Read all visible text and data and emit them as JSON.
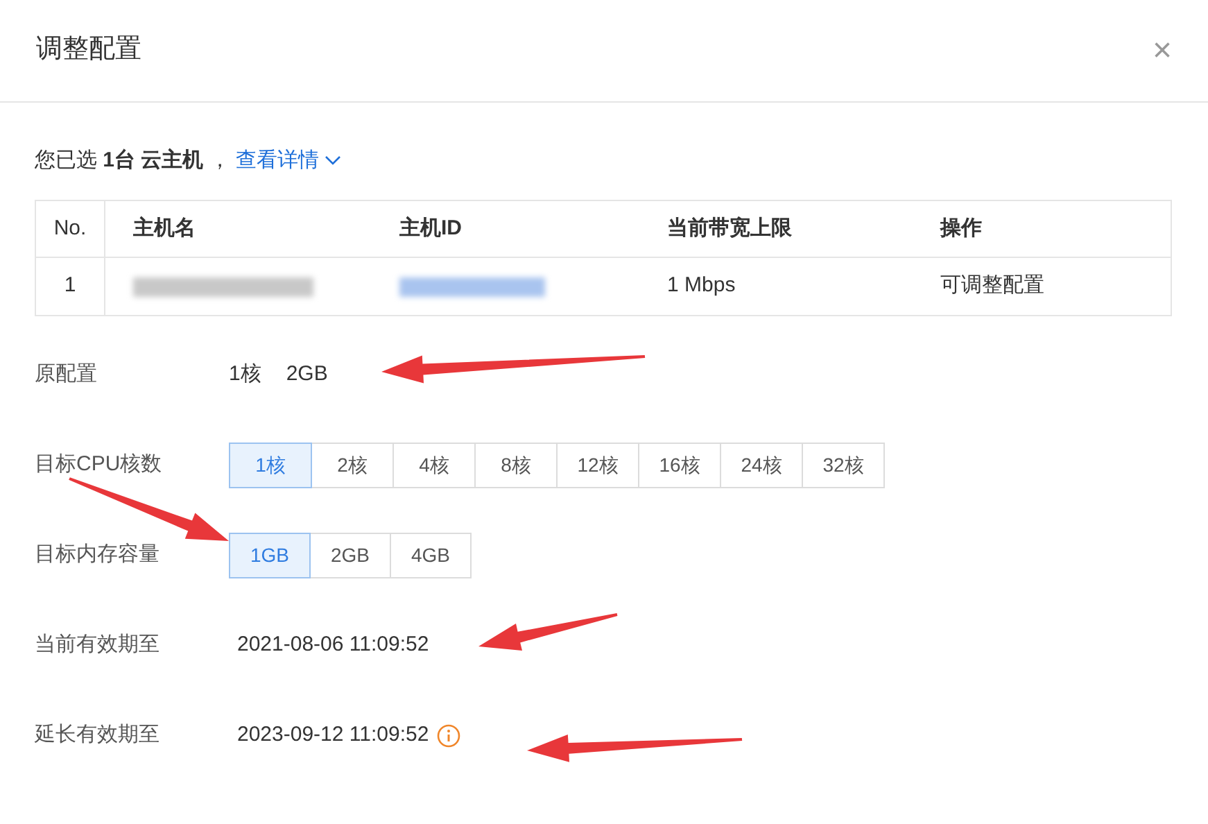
{
  "dialog": {
    "title": "调整配置",
    "close": "×"
  },
  "summary": {
    "text": "您已选 **1台 云主机** ，",
    "link": "查看详情"
  },
  "table": {
    "columns": [
      "No.",
      "主机名",
      "主机ID",
      "当前带宽上限",
      "操作"
    ],
    "rows": [
      {
        "no": "1",
        "bandwidth": "1 Mbps",
        "action": "可调整配置"
      }
    ]
  },
  "original": {
    "label": "原配置",
    "cpu": "1核",
    "memory": "2GB"
  },
  "cpu": {
    "label": "目标CPU核数",
    "options": [
      {
        "label": "1核",
        "selected": true
      },
      {
        "label": "2核",
        "selected": false
      },
      {
        "label": "4核",
        "selected": false
      },
      {
        "label": "8核",
        "selected": false
      },
      {
        "label": "12核",
        "selected": false
      },
      {
        "label": "16核",
        "selected": false
      },
      {
        "label": "24核",
        "selected": false
      },
      {
        "label": "32核",
        "selected": false
      }
    ]
  },
  "memory": {
    "label": "目标内存容量",
    "options": [
      {
        "label": "1GB",
        "selected": true
      },
      {
        "label": "2GB",
        "selected": false
      },
      {
        "label": "4GB",
        "selected": false
      }
    ]
  },
  "current_expiry": {
    "label": "当前有效期至",
    "value": "2021-08-06 11:09:52"
  },
  "extended_expiry": {
    "label": "延长有效期至",
    "value": "2023-09-12 11:09:52"
  }
}
